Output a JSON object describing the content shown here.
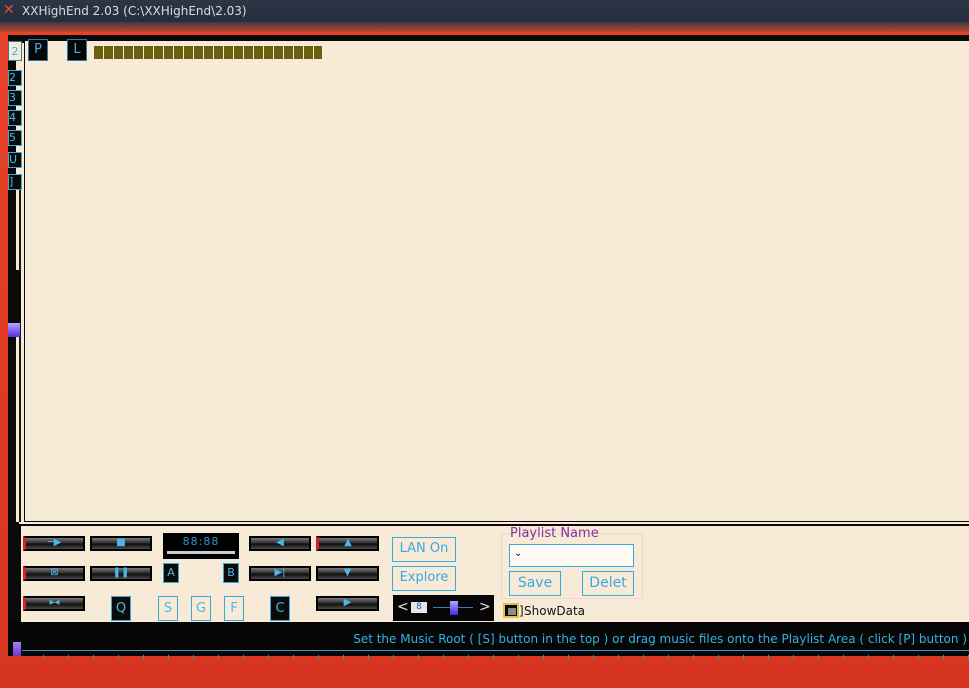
{
  "window": {
    "title": "XXHighEnd 2.03 (C:\\XXHighEnd\\2.03)",
    "logo_icon": "x-logo-icon",
    "accent": "#e0532f"
  },
  "playlist_tabs": {
    "top_num": "2",
    "p": "P",
    "l": "L",
    "side": [
      "2",
      "3",
      "4",
      "5",
      "U",
      "]"
    ]
  },
  "transport": {
    "left_column_labels": [
      "",
      "",
      ""
    ],
    "mid_labels": {
      "a": "A",
      "b": "B",
      "q": "Q",
      "s": "S",
      "g": "G",
      "f": "F",
      "c": "C"
    },
    "clock": "88:88"
  },
  "buttons": {
    "lan": "LAN On",
    "explore": "Explore"
  },
  "playlist_name": {
    "label": "Playlist Name",
    "value": "",
    "save": "Save",
    "delete": "Delet"
  },
  "page_nav": {
    "prev": "<",
    "next": ">",
    "page": "8"
  },
  "show_data": {
    "label": "ShowData"
  },
  "status": {
    "message": "Set the Music Root ( [S] button in the top ) or drag music files onto the Playlist Area ( click [P] button )"
  },
  "colors": {
    "frame": "#0a0a0a",
    "panel": "#f7ebd8",
    "accent_blue": "#38a9de",
    "background_red": "#e03a22"
  }
}
